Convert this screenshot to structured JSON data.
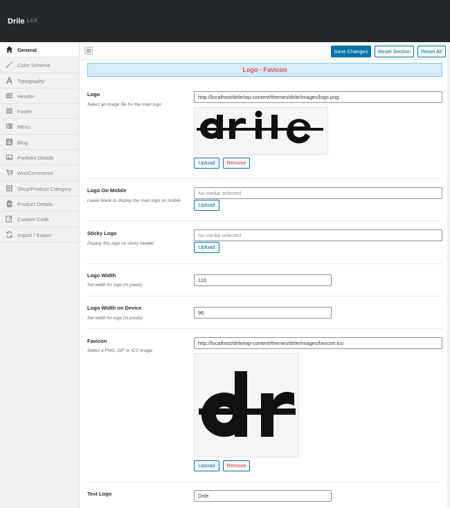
{
  "app": {
    "title": "Drile",
    "version": "1.0.0"
  },
  "sidebar": {
    "items": [
      {
        "label": "General",
        "icon": "home-icon",
        "active": true
      },
      {
        "label": "Color Scheme",
        "icon": "brush-icon"
      },
      {
        "label": "Typography",
        "icon": "typography-icon"
      },
      {
        "label": "Header",
        "icon": "menu-lines-icon"
      },
      {
        "label": "Footer",
        "icon": "menu-lines-icon"
      },
      {
        "label": "Menu",
        "icon": "list-icon"
      },
      {
        "label": "Blog",
        "icon": "blog-icon"
      },
      {
        "label": "Portfolio Details",
        "icon": "portfolio-icon"
      },
      {
        "label": "WooCommerce",
        "icon": "cart-icon"
      },
      {
        "label": "Shop/Product Category",
        "icon": "grid-icon"
      },
      {
        "label": "Product Details",
        "icon": "clipboard-icon"
      },
      {
        "label": "Custom Code",
        "icon": "edit-icon"
      },
      {
        "label": "Import / Export",
        "icon": "refresh-icon"
      }
    ]
  },
  "toolbar": {
    "save_label": "Save Changes",
    "reset_section_label": "Reset Section",
    "reset_all_label": "Reset All"
  },
  "section": {
    "title": "Logo - Favicon"
  },
  "fields": {
    "logo": {
      "label": "Logo",
      "desc": "Select an image file for the main logo",
      "value": "http://localhost/drile/wp-content/themes/drile/images/logo.png",
      "upload_label": "Upload",
      "remove_label": "Remove"
    },
    "logo_mobile": {
      "label": "Logo On Mobile",
      "desc": "Leave blank to display the main logo on mobile",
      "placeholder": "No media selected",
      "upload_label": "Upload"
    },
    "sticky_logo": {
      "label": "Sticky Logo",
      "desc": "Display this logo on sticky header",
      "placeholder": "No media selected",
      "upload_label": "Upload"
    },
    "logo_width": {
      "label": "Logo Width",
      "desc": "Set width for logo (in pixels)",
      "value": "110"
    },
    "logo_width_device": {
      "label": "Logo Width on Device",
      "desc": "Set width for logo (in pixels)",
      "value": "96"
    },
    "favicon": {
      "label": "Favicon",
      "desc": "Select a PNG, GIF or ICO image",
      "value": "http://localhost/drile/wp-content/themes/drile/images/favicon.ico",
      "upload_label": "Upload",
      "remove_label": "Remove"
    },
    "text_logo": {
      "label": "Text Logo",
      "value": "Drile"
    }
  },
  "colors": {
    "topbar": "#23282d",
    "primary": "#0073aa",
    "section_bg": "#d3ecf7",
    "section_text": "#e24d4d",
    "remove_text": "#dc3232"
  }
}
